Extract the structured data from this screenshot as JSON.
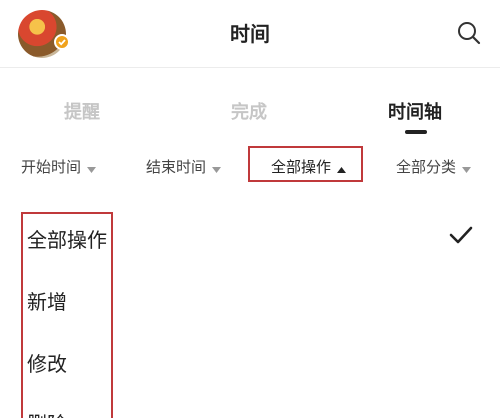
{
  "header": {
    "title": "时间"
  },
  "tabs": [
    {
      "label": "提醒"
    },
    {
      "label": "完成"
    },
    {
      "label": "时间轴"
    }
  ],
  "filters": [
    {
      "label": "开始时间"
    },
    {
      "label": "结束时间"
    },
    {
      "label": "全部操作"
    },
    {
      "label": "全部分类"
    }
  ],
  "dropdown": {
    "selected": "全部操作",
    "options": [
      {
        "label": "全部操作"
      },
      {
        "label": "新增"
      },
      {
        "label": "修改"
      },
      {
        "label": "删除"
      }
    ]
  },
  "colors": {
    "highlight_border": "#c0393b",
    "badge": "#f0a21c"
  }
}
